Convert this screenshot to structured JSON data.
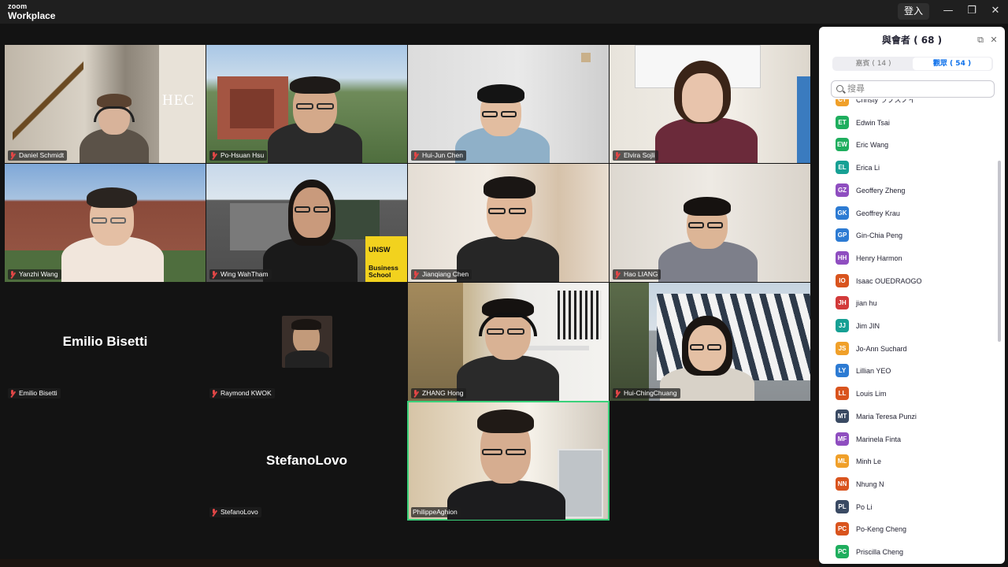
{
  "app": {
    "logo_top": "zoom",
    "logo_bottom": "Workplace",
    "login_label": "登入"
  },
  "window_controls": {
    "minimize": "—",
    "restore": "❐",
    "close": "✕"
  },
  "participants_panel": {
    "title": "與會者 ( 68 )",
    "tabs": [
      {
        "label": "嘉賓 ( 14 )",
        "selected": false
      },
      {
        "label": "觀眾 ( 54 )",
        "selected": true
      }
    ],
    "search_placeholder": "搜尋",
    "attendees": [
      {
        "initials": "CT",
        "name": "Christy ラブスノイ",
        "color": "#f0a02a"
      },
      {
        "initials": "ET",
        "name": "Edwin Tsai",
        "color": "#1fae5e"
      },
      {
        "initials": "EW",
        "name": "Eric Wang",
        "color": "#1fae5e"
      },
      {
        "initials": "EL",
        "name": "Erica Li",
        "color": "#17a094"
      },
      {
        "initials": "GZ",
        "name": "Geoffery Zheng",
        "color": "#8f4ec0"
      },
      {
        "initials": "GK",
        "name": "Geoffrey Krau",
        "color": "#2d7bd3"
      },
      {
        "initials": "GP",
        "name": "Gin-Chia Peng",
        "color": "#2d7bd3"
      },
      {
        "initials": "HH",
        "name": "Henry Harmon",
        "color": "#8f4ec0"
      },
      {
        "initials": "IO",
        "name": "Isaac OUEDRAOGO",
        "color": "#d9541e"
      },
      {
        "initials": "JH",
        "name": "jian hu",
        "color": "#d23a3a"
      },
      {
        "initials": "JJ",
        "name": "Jim JIN",
        "color": "#17a094"
      },
      {
        "initials": "JS",
        "name": "Jo-Ann Suchard",
        "color": "#f0a02a"
      },
      {
        "initials": "LY",
        "name": "Lillian YEO",
        "color": "#2d7bd3"
      },
      {
        "initials": "LL",
        "name": "Louis Lim",
        "color": "#d9541e"
      },
      {
        "initials": "MT",
        "name": "Maria Teresa Punzi",
        "color": "#3a4a63"
      },
      {
        "initials": "MF",
        "name": "Marinela Finta",
        "color": "#8f4ec0"
      },
      {
        "initials": "ML",
        "name": "Minh Le",
        "color": "#f0a02a"
      },
      {
        "initials": "NN",
        "name": "Nhung N",
        "color": "#d9541e"
      },
      {
        "initials": "PL",
        "name": "Po Li",
        "color": "#3a4a63"
      },
      {
        "initials": "PC",
        "name": "Po-Keng Cheng",
        "color": "#d9541e"
      },
      {
        "initials": "PC",
        "name": "Priscilla Cheng",
        "color": "#1fae5e"
      }
    ]
  },
  "video_tiles": [
    {
      "name": "Daniel Schmidt",
      "overlay": "HEC"
    },
    {
      "name": "Po-Hsuan Hsu"
    },
    {
      "name": "Hui-Jun Chen"
    },
    {
      "name": "Elvira Sojli"
    },
    {
      "name": "Yanzhi Wang"
    },
    {
      "name": "Wing WahTham",
      "overlay_top": "UNSW",
      "overlay_bottom": "Business School"
    },
    {
      "name": "Jianqiang Chen"
    },
    {
      "name": "Hao LIANG"
    },
    {
      "name": "Emilio Bisetti",
      "big_name": "Emilio Bisetti"
    },
    {
      "name": "Raymond KWOK"
    },
    {
      "name": "ZHANG Hong"
    },
    {
      "name": "Hui-ChingChuang"
    },
    {
      "name": "StefanoLovo",
      "big_name": "StefanoLovo"
    },
    {
      "name": "PhilippeAghion",
      "active_speaker": true
    }
  ]
}
